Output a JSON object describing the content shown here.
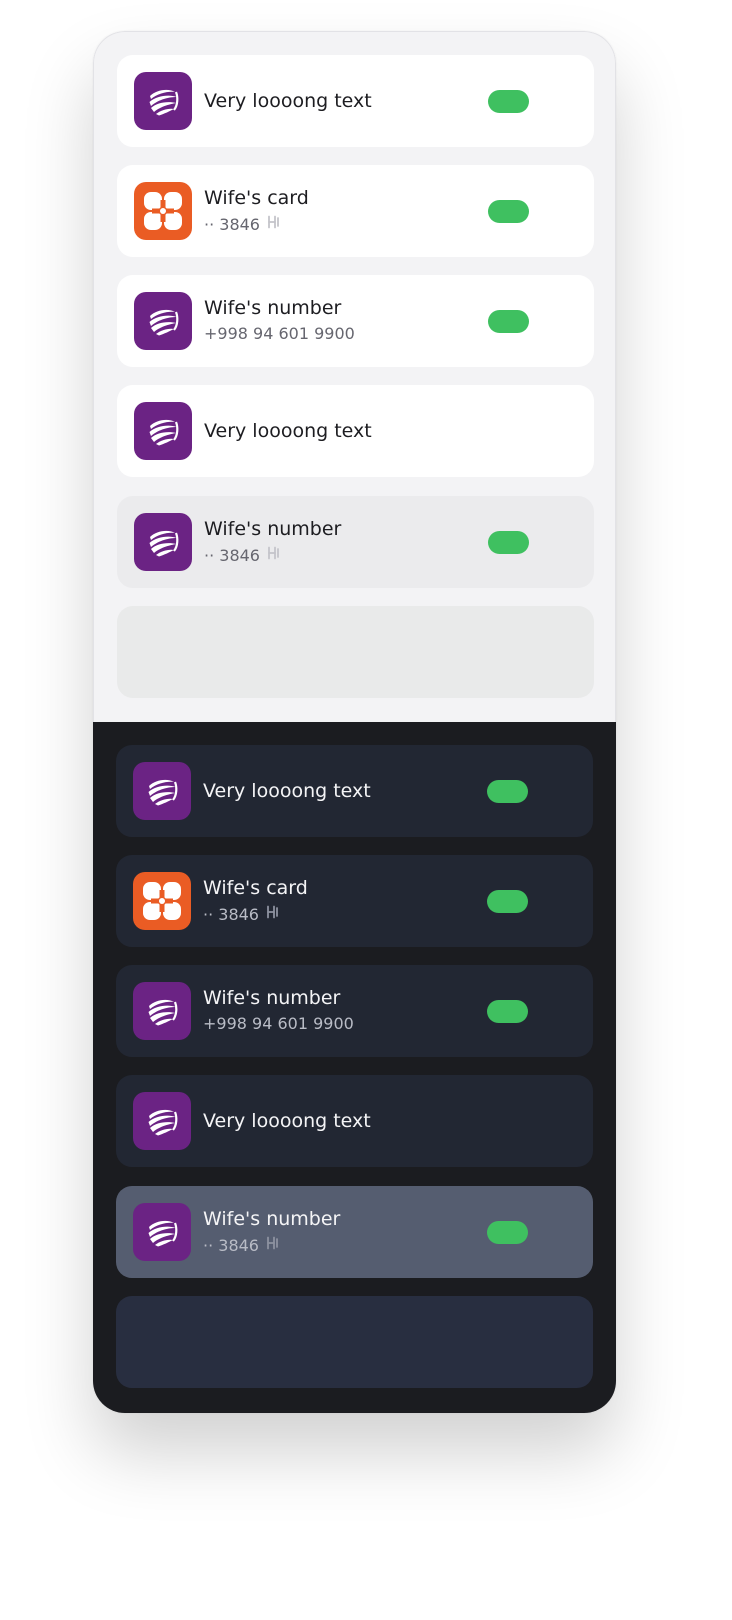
{
  "colors": {
    "toggle_on": "#3fc060",
    "ucell_brand": "#6b2384",
    "humo_brand": "#ea5c24",
    "light_bg": "#f3f3f5",
    "dark_bg": "#1b1c20"
  },
  "light_list": [
    {
      "logo": "ucell-logo",
      "title": "Very loooong text",
      "subtitle": null,
      "toggle": true,
      "state": "default"
    },
    {
      "logo": "humo-logo",
      "title": "Wife's card",
      "subtitle": "·· 3846",
      "chip_icon": "humo-chip-icon",
      "toggle": true,
      "state": "default"
    },
    {
      "logo": "ucell-logo",
      "title": "Wife's number",
      "subtitle": "+998 94 601 9900",
      "toggle": true,
      "state": "default"
    },
    {
      "logo": "ucell-logo",
      "title": "Very loooong text",
      "subtitle": null,
      "toggle": false,
      "state": "default"
    },
    {
      "logo": "ucell-logo",
      "title": "Wife's number",
      "subtitle": "·· 3846",
      "chip_icon": "humo-chip-icon",
      "toggle": true,
      "state": "hover"
    },
    {
      "state": "disabled-empty"
    }
  ],
  "dark_list": [
    {
      "logo": "ucell-logo",
      "title": "Very loooong text",
      "subtitle": null,
      "toggle": true,
      "state": "default"
    },
    {
      "logo": "humo-logo",
      "title": "Wife's card",
      "subtitle": "·· 3846",
      "chip_icon": "humo-chip-icon",
      "toggle": true,
      "state": "default"
    },
    {
      "logo": "ucell-logo",
      "title": "Wife's number",
      "subtitle": "+998 94 601 9900",
      "toggle": true,
      "state": "default"
    },
    {
      "logo": "ucell-logo",
      "title": "Very loooong text",
      "subtitle": null,
      "toggle": false,
      "state": "default"
    },
    {
      "logo": "ucell-logo",
      "title": "Wife's number",
      "subtitle": "·· 3846",
      "chip_icon": "humo-chip-icon",
      "toggle": true,
      "state": "hover"
    },
    {
      "state": "disabled-empty"
    }
  ]
}
